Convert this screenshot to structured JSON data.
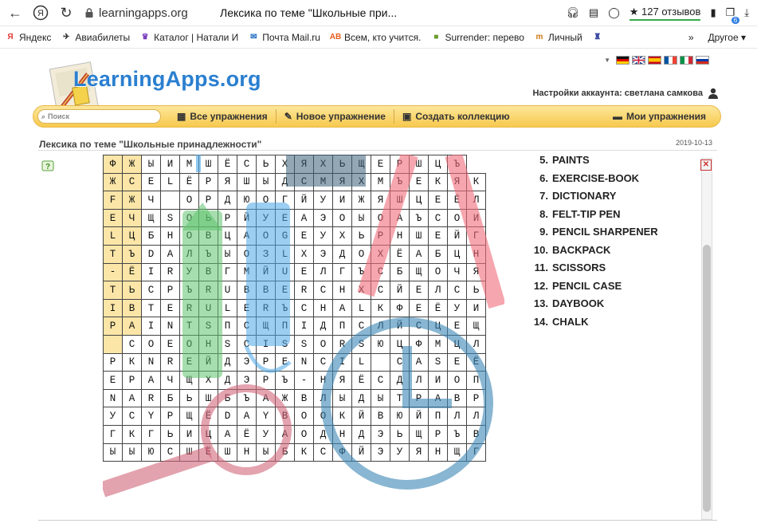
{
  "browser": {
    "url": "learningapps.org",
    "tab_title": "Лексика по теме \"Школьные при...",
    "reviews": "★ 127 отзывов",
    "badge": "6"
  },
  "bookmarks": [
    {
      "label": "Яндекс",
      "icon": "yandex-icon",
      "icon_text": "Я",
      "color": "#e53935"
    },
    {
      "label": "Авиабилеты",
      "icon": "plane-icon",
      "icon_text": "✈",
      "color": "#2e2e2e"
    },
    {
      "label": "Каталог | Натали И",
      "icon": "dress-icon",
      "icon_text": "♛",
      "color": "#7b3fbf"
    },
    {
      "label": "Почта Mail.ru",
      "icon": "mail-icon",
      "icon_text": "✉",
      "color": "#1565c0"
    },
    {
      "label": "Всем, кто учится.",
      "icon": "ab-icon",
      "icon_text": "AB",
      "color": "#e55b1f"
    },
    {
      "label": "Surrender: перево",
      "icon": "dictionary-icon",
      "icon_text": "■",
      "color": "#6a9a2a"
    },
    {
      "label": "Личный",
      "icon": "tn-icon",
      "icon_text": "m",
      "color": "#d07a12"
    },
    {
      "label": "",
      "icon": "castle-icon",
      "icon_text": "♜",
      "color": "#3a4aa0"
    }
  ],
  "bookmarks_more": "»",
  "bookmarks_other": "Другое",
  "site": {
    "logo": "LearningApps.org",
    "account": "Настройки аккаунта: светлана самкова",
    "search_placeholder": "Поиск",
    "menu": [
      {
        "label": "Все упражнения",
        "icon": "grid-icon"
      },
      {
        "label": "Новое упражнение",
        "icon": "pencil-icon"
      },
      {
        "label": "Создать коллекцию",
        "icon": "collection-icon"
      },
      {
        "label": "Мои упражнения",
        "icon": "folder-icon"
      }
    ],
    "subtitle": "Лексика по теме \"Школьные принадлежности\"",
    "date": "2019-10-13"
  },
  "grid_rows": [
    "ФЖЫИМШЁСЬХЯХЬЩЕРШЦЪ",
    "ЖСЕLЁРЯШЫДСМЯХМЪЕКЯК",
    "FЖЧ ОРДЮОГЙУИЖЯШЦЕЁЛ",
    "ЕЧЩSОЬРЙУЕАЭОЫОАЪСОИ",
    "LЦБНОВЦАОGЕУХЬРНШЕЙГ",
    "ТЪDАЛЪЫОЗLХЭДОХЁАБЦН",
    "-ЁIRУВГМЙUЕЛГЪСБЩОЧЯ",
    "ТЬСРЪRUВВЕRСНХСЙЕЛСЬ",
    "IВТЕRULЕRЪСНАLКФЕЁУИ",
    "РАINТSПСЩПIДПСЛЙСЦЕЩ",
    " СОЕОНSСISSORSЮЦФМЦЛ",
    "РКNRЕЙДЭРЕNСIL САSЕЁ",
    "ЕРАЧЩХДЭРЪ-НЯЁСДЛИОП",
    "NАRБЬШБЪАЖВЛЫДЫТРАВР",
    "УСYРЩЁDАYВООКЙВЮЙПЛЛ",
    "ГКГЬИЦАЁУАОДНДЭЬЩРЪВ",
    "ЫЫЮСШЁШНЫБКСФЙЭУЯНЩГ"
  ],
  "found_cells": [
    "0,0",
    "0,1",
    "1,0",
    "1,1",
    "2,0",
    "2,1",
    "3,0",
    "3,1",
    "4,0",
    "4,1",
    "5,0",
    "5,1",
    "6,0",
    "6,1",
    "7,0",
    "7,1",
    "8,0",
    "8,1",
    "9,0",
    "9,1",
    "10,0"
  ],
  "word_list": [
    {
      "n": "5.",
      "w": "PAINTS"
    },
    {
      "n": "6.",
      "w": "EXERCISE-BOOK"
    },
    {
      "n": "7.",
      "w": "DICTIONARY"
    },
    {
      "n": "8.",
      "w": "FELT-TIP PEN"
    },
    {
      "n": "9.",
      "w": "PENCIL SHARPENER"
    },
    {
      "n": "10.",
      "w": "BACKPACK"
    },
    {
      "n": "11.",
      "w": "SCISSORS"
    },
    {
      "n": "12.",
      "w": "PENCIL CASE"
    },
    {
      "n": "13.",
      "w": "DAYBOOK"
    },
    {
      "n": "14.",
      "w": "CHALK"
    }
  ],
  "colors": {
    "found_cell": "#fbe6a8",
    "marker_green": "#5ec26e",
    "marker_blue": "#4aa6e6",
    "pink": "#f06b78",
    "clock": "#3a86b4",
    "magnifier": "#d0657a",
    "menubar": "#f7c94e"
  }
}
